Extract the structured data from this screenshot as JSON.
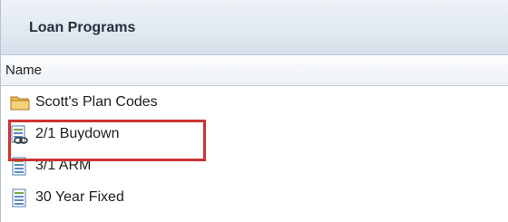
{
  "panel": {
    "title": "Loan Programs",
    "column_header": "Name"
  },
  "items": [
    {
      "label": "Scott's Plan Codes",
      "icon": "folder-icon"
    },
    {
      "label": "2/1 Buydown",
      "icon": "linked-document-icon"
    },
    {
      "label": "3/1 ARM",
      "icon": "document-icon"
    },
    {
      "label": "30 Year Fixed",
      "icon": "document-icon"
    }
  ],
  "colors": {
    "highlight_border": "#cc3333",
    "header_gradient_top": "#eef3f8",
    "header_gradient_bottom": "#d6e0ea"
  }
}
